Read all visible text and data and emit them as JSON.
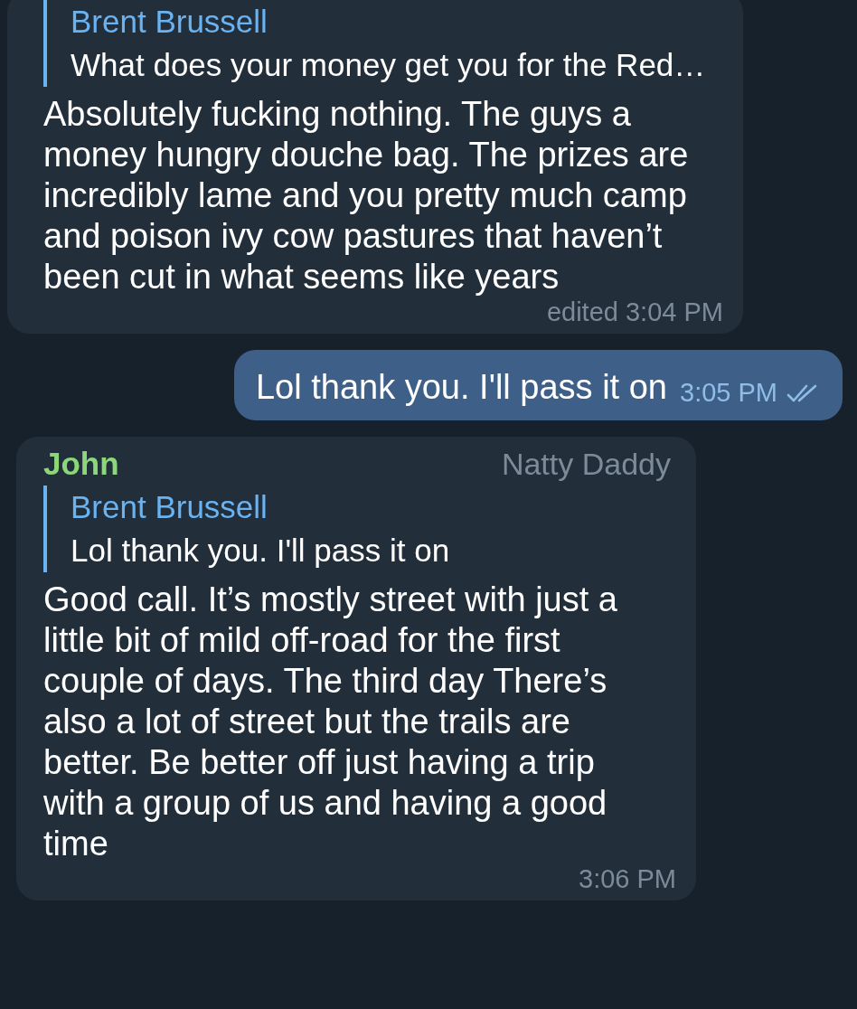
{
  "messages": [
    {
      "kind": "incoming",
      "reply": {
        "name": "Brent Brussell",
        "text": "What does your money get you for the Red…"
      },
      "text": "Absolutely fucking nothing. The guys a money hungry douche bag. The prizes are incredibly lame and you pretty much camp and poison ivy cow pastures that haven’t been cut in what seems like years",
      "time": "edited 3:04 PM"
    },
    {
      "kind": "outgoing",
      "text": "Lol thank you. I'll pass it on",
      "time": "3:05 PM",
      "read": true
    },
    {
      "kind": "incoming",
      "sender": "John",
      "sender_title": "Natty Daddy",
      "reply": {
        "name": "Brent Brussell",
        "text": "Lol thank you. I'll pass it on"
      },
      "text": "Good call. It’s mostly street with just a little bit of mild off-road for the first couple of days.  The third day There’s also a lot of street but the trails are better. Be better off just having a trip with a group of us and having a good time",
      "time": "3:06 PM"
    }
  ]
}
